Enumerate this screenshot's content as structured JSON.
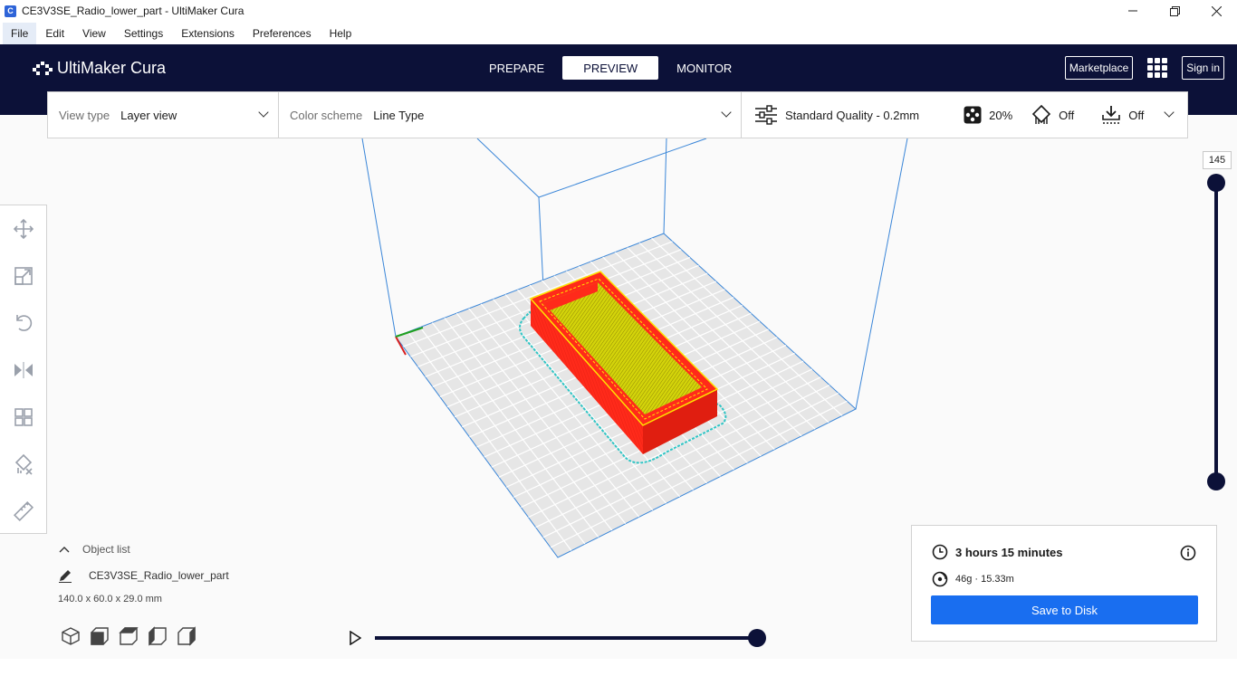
{
  "window": {
    "title": "CE3V3SE_Radio_lower_part - UltiMaker Cura",
    "icon_letter": "C",
    "controls": [
      "minimize-icon",
      "restore-icon",
      "close-icon"
    ]
  },
  "menu": [
    "File",
    "Edit",
    "View",
    "Settings",
    "Extensions",
    "Preferences",
    "Help"
  ],
  "header": {
    "logo": "UltiMaker Cura",
    "stages": [
      "PREPARE",
      "PREVIEW",
      "MONITOR"
    ],
    "active_stage": "PREVIEW",
    "marketplace_label": "Marketplace",
    "signin_label": "Sign in"
  },
  "view_settings": {
    "view_type_label": "View type",
    "view_type_value": "Layer view",
    "color_scheme_label": "Color scheme",
    "color_scheme_value": "Line Type"
  },
  "print_setup": {
    "profile": "Standard Quality - 0.2mm",
    "infill": "20%",
    "support": "Off",
    "adhesion": "Off"
  },
  "tools": [
    "move-tool",
    "scale-tool",
    "rotate-tool",
    "mirror-tool",
    "per-model-settings-tool",
    "support-blocker-tool",
    "measure-tool"
  ],
  "layer_slider": {
    "current_layer": "145"
  },
  "object_list": {
    "title": "Object list",
    "object_name": "CE3V3SE_Radio_lower_part",
    "dimensions": "140.0 x 60.0 x 29.0 mm"
  },
  "camera_views": [
    "3d-view",
    "front-view",
    "top-view",
    "left-view",
    "right-view"
  ],
  "simulation": {
    "progress": 1.0
  },
  "output": {
    "print_time": "3 hours 15 minutes",
    "material": "46g · 15.33m",
    "save_label": "Save to Disk"
  },
  "colors": {
    "header_bg": "#0c1138",
    "accent_blue": "#196ef0",
    "wall_red": "#ff2a1a",
    "infill_yellow": "#d4d40a",
    "skirt_cyan": "#2fc5c5",
    "build_volume_blue": "#3a86d8"
  }
}
